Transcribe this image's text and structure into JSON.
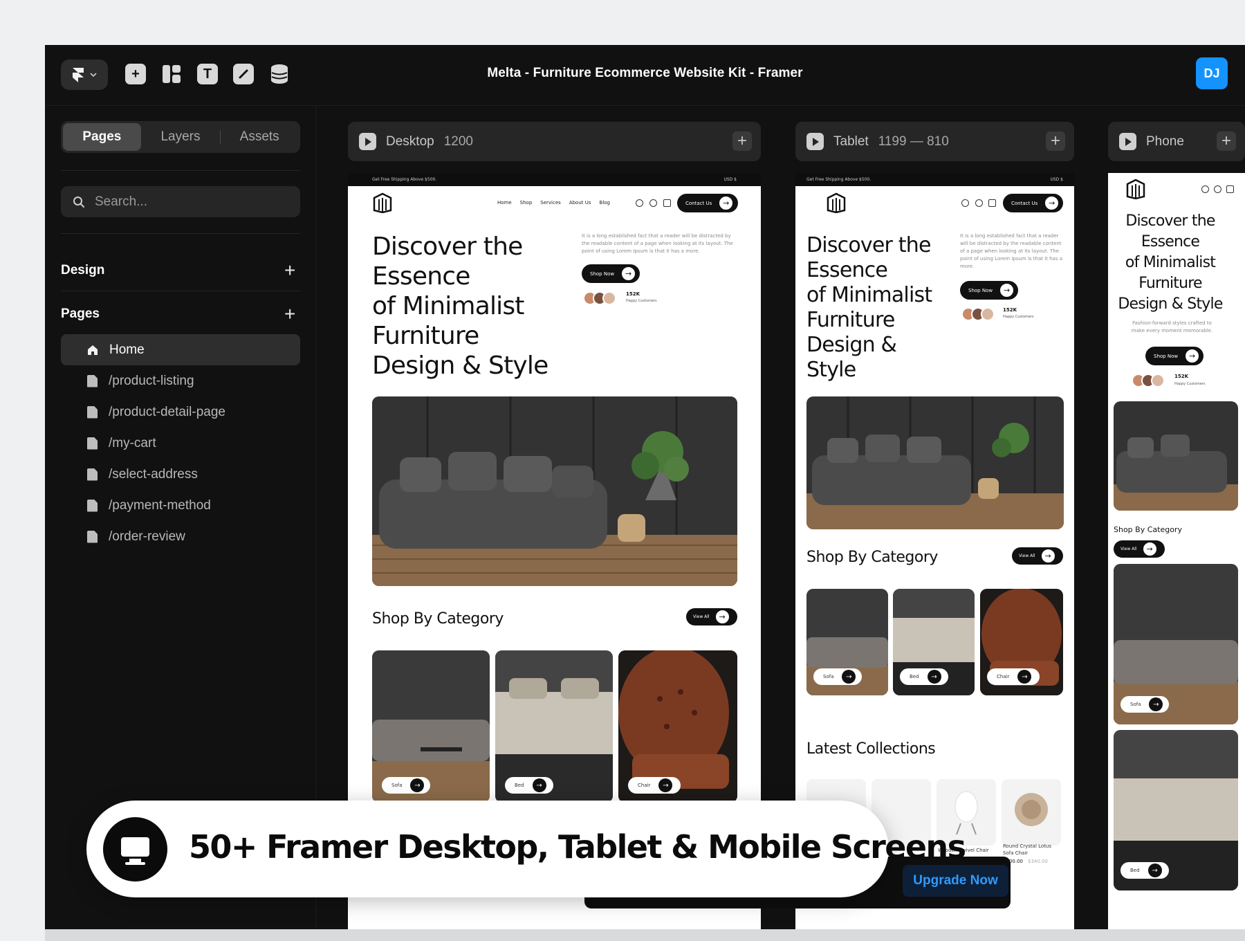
{
  "window": {
    "title": "Melta - Furniture Ecommerce Website Kit - Framer",
    "avatar_initials": "DJ",
    "accent_color": "#1493ff"
  },
  "toolbar": {
    "tools": [
      "insert-icon",
      "layout-icon",
      "text-icon",
      "link-icon",
      "cms-icon"
    ]
  },
  "sidebar": {
    "tabs": [
      "Pages",
      "Layers",
      "Assets"
    ],
    "active_tab": "Pages",
    "search_placeholder": "Search...",
    "design_label": "Design",
    "pages_label": "Pages",
    "pages": [
      {
        "label": "Home",
        "icon": "home-icon"
      },
      {
        "label": "/product-listing",
        "icon": "file-icon"
      },
      {
        "label": "/product-detail-page",
        "icon": "file-icon"
      },
      {
        "label": "/my-cart",
        "icon": "file-icon"
      },
      {
        "label": "/select-address",
        "icon": "file-icon"
      },
      {
        "label": "/payment-method",
        "icon": "file-icon"
      },
      {
        "label": "/order-review",
        "icon": "file-icon"
      }
    ]
  },
  "frames": {
    "desktop": {
      "label": "Desktop",
      "size": "1200"
    },
    "tablet": {
      "label": "Tablet",
      "size": "1199 — 810"
    },
    "phone": {
      "label": "Phone"
    }
  },
  "site": {
    "promo": "Get Free Shipping Above $500.",
    "currency": "USD $",
    "nav": [
      "Home",
      "Shop",
      "Services",
      "About Us",
      "Blog"
    ],
    "contact": "Contact Us",
    "hero_lines": [
      "Discover the",
      "Essence",
      "of Minimalist",
      "Furniture",
      "Design & Style"
    ],
    "tablet_hero_lines": [
      "Discover the",
      "Essence",
      "of Minimalist",
      "Furniture",
      "Design &",
      "Style"
    ],
    "phone_hero_lines": [
      "Discover the",
      "Essence",
      "of Minimalist",
      "Furniture",
      "Design & Style"
    ],
    "blurb": "It is a long established fact that a reader will be distracted by the readable content of a page when looking at its layout. The point of using Lorem Ipsum is that it has a more.",
    "phone_blurb": "Fashion-forward styles crafted to make every moment memorable.",
    "shop_now": "Shop Now",
    "customers_count": "152K",
    "customers_label": "Happy Customers",
    "shop_by_category": "Shop By Category",
    "view_all": "View All",
    "categories": [
      "Sofa",
      "Bed",
      "Chair"
    ],
    "latest_collections": "Latest Collections",
    "products": [
      {
        "name": "Wooden Swivel Chair"
      },
      {
        "name": "Round Crystal Lotus Sofa Chair",
        "price": "$300.00",
        "old_price": "$340.00"
      }
    ]
  },
  "banner": {
    "text": "50+ Framer Desktop, Tablet & Mobile Screens",
    "icon": "monitor-icon"
  },
  "upgrade": {
    "label": "Upgrade Now"
  }
}
